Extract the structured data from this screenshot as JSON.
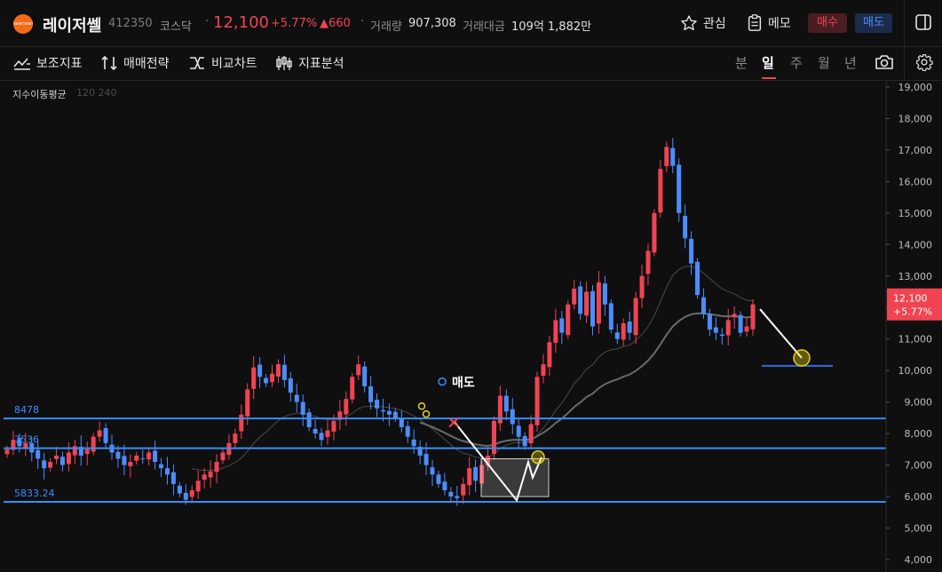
{
  "header": {
    "logo_text": "laserssel",
    "name": "레이저쎌",
    "code": "412350",
    "market": "코스닥",
    "separator": "·",
    "price": "12,100",
    "change_pct": "+5.77%",
    "change_abs": "▲660",
    "volume_label": "거래량",
    "volume": "907,308",
    "amount_label": "거래대금",
    "amount": "109억 1,882만",
    "watch_label": "관심",
    "memo_label": "메모",
    "buy_label": "매수",
    "sell_label": "매도"
  },
  "toolbar": {
    "tools": [
      "보조지표",
      "매매전략",
      "비교차트",
      "지표분석"
    ],
    "periods": [
      "분",
      "일",
      "주",
      "월",
      "년"
    ],
    "active_period": "일"
  },
  "indicator": {
    "label": "지수이동평균",
    "params": "120 240"
  },
  "colors": {
    "up": "#f04452",
    "down": "#4d8dff",
    "hline": "#3a8df7",
    "bg": "#0f0f10"
  },
  "chart_data": {
    "type": "candlestick",
    "ylim": [
      4000,
      19000
    ],
    "yticks": [
      "19,000",
      "18,000",
      "17,000",
      "16,000",
      "15,000",
      "14,000",
      "13,000",
      "12,000",
      "11,000",
      "10,000",
      "9,000",
      "8,000",
      "7,000",
      "6,000",
      "5,000",
      "4,000"
    ],
    "last_price": {
      "value": 12100,
      "label": "12,100",
      "pct": "+5.77%"
    },
    "hlines": [
      {
        "value": 8478,
        "label": "8478"
      },
      {
        "value": 7536,
        "label": "7536"
      },
      {
        "value": 5833.24,
        "label": "5833.24"
      }
    ],
    "target_line_value": 10150,
    "annotations": [
      {
        "text": "매도",
        "value": 9650
      }
    ],
    "closes": [
      7500,
      7800,
      7600,
      7700,
      7400,
      7200,
      6900,
      7100,
      7300,
      7000,
      7400,
      7600,
      7300,
      7500,
      7900,
      8100,
      7700,
      7400,
      7200,
      7000,
      7100,
      7300,
      7200,
      7400,
      7100,
      6900,
      6700,
      6400,
      6100,
      5900,
      6200,
      6500,
      6700,
      6800,
      7100,
      7400,
      7700,
      8000,
      8600,
      9400,
      10100,
      9800,
      9600,
      9900,
      10200,
      9700,
      9300,
      9000,
      8600,
      8200,
      8000,
      7800,
      8100,
      8400,
      8700,
      9100,
      9800,
      10200,
      9500,
      9000,
      8800,
      8700,
      8600,
      8500,
      8200,
      7900,
      7600,
      7300,
      7000,
      6700,
      6400,
      6200,
      6000,
      5950,
      6400,
      6900,
      6500,
      7000,
      7300,
      8400,
      9200,
      8700,
      8300,
      7900,
      7600,
      8300,
      9800,
      10200,
      10900,
      11600,
      11200,
      12100,
      12600,
      11800,
      12500,
      11400,
      12800,
      12100,
      11300,
      11000,
      11500,
      11200,
      12300,
      13000,
      13800,
      15000,
      16400,
      17100,
      16500,
      15000,
      14200,
      13400,
      12400,
      11800,
      11300,
      11200,
      11100,
      11600,
      11800,
      11200,
      11400,
      12100
    ]
  }
}
